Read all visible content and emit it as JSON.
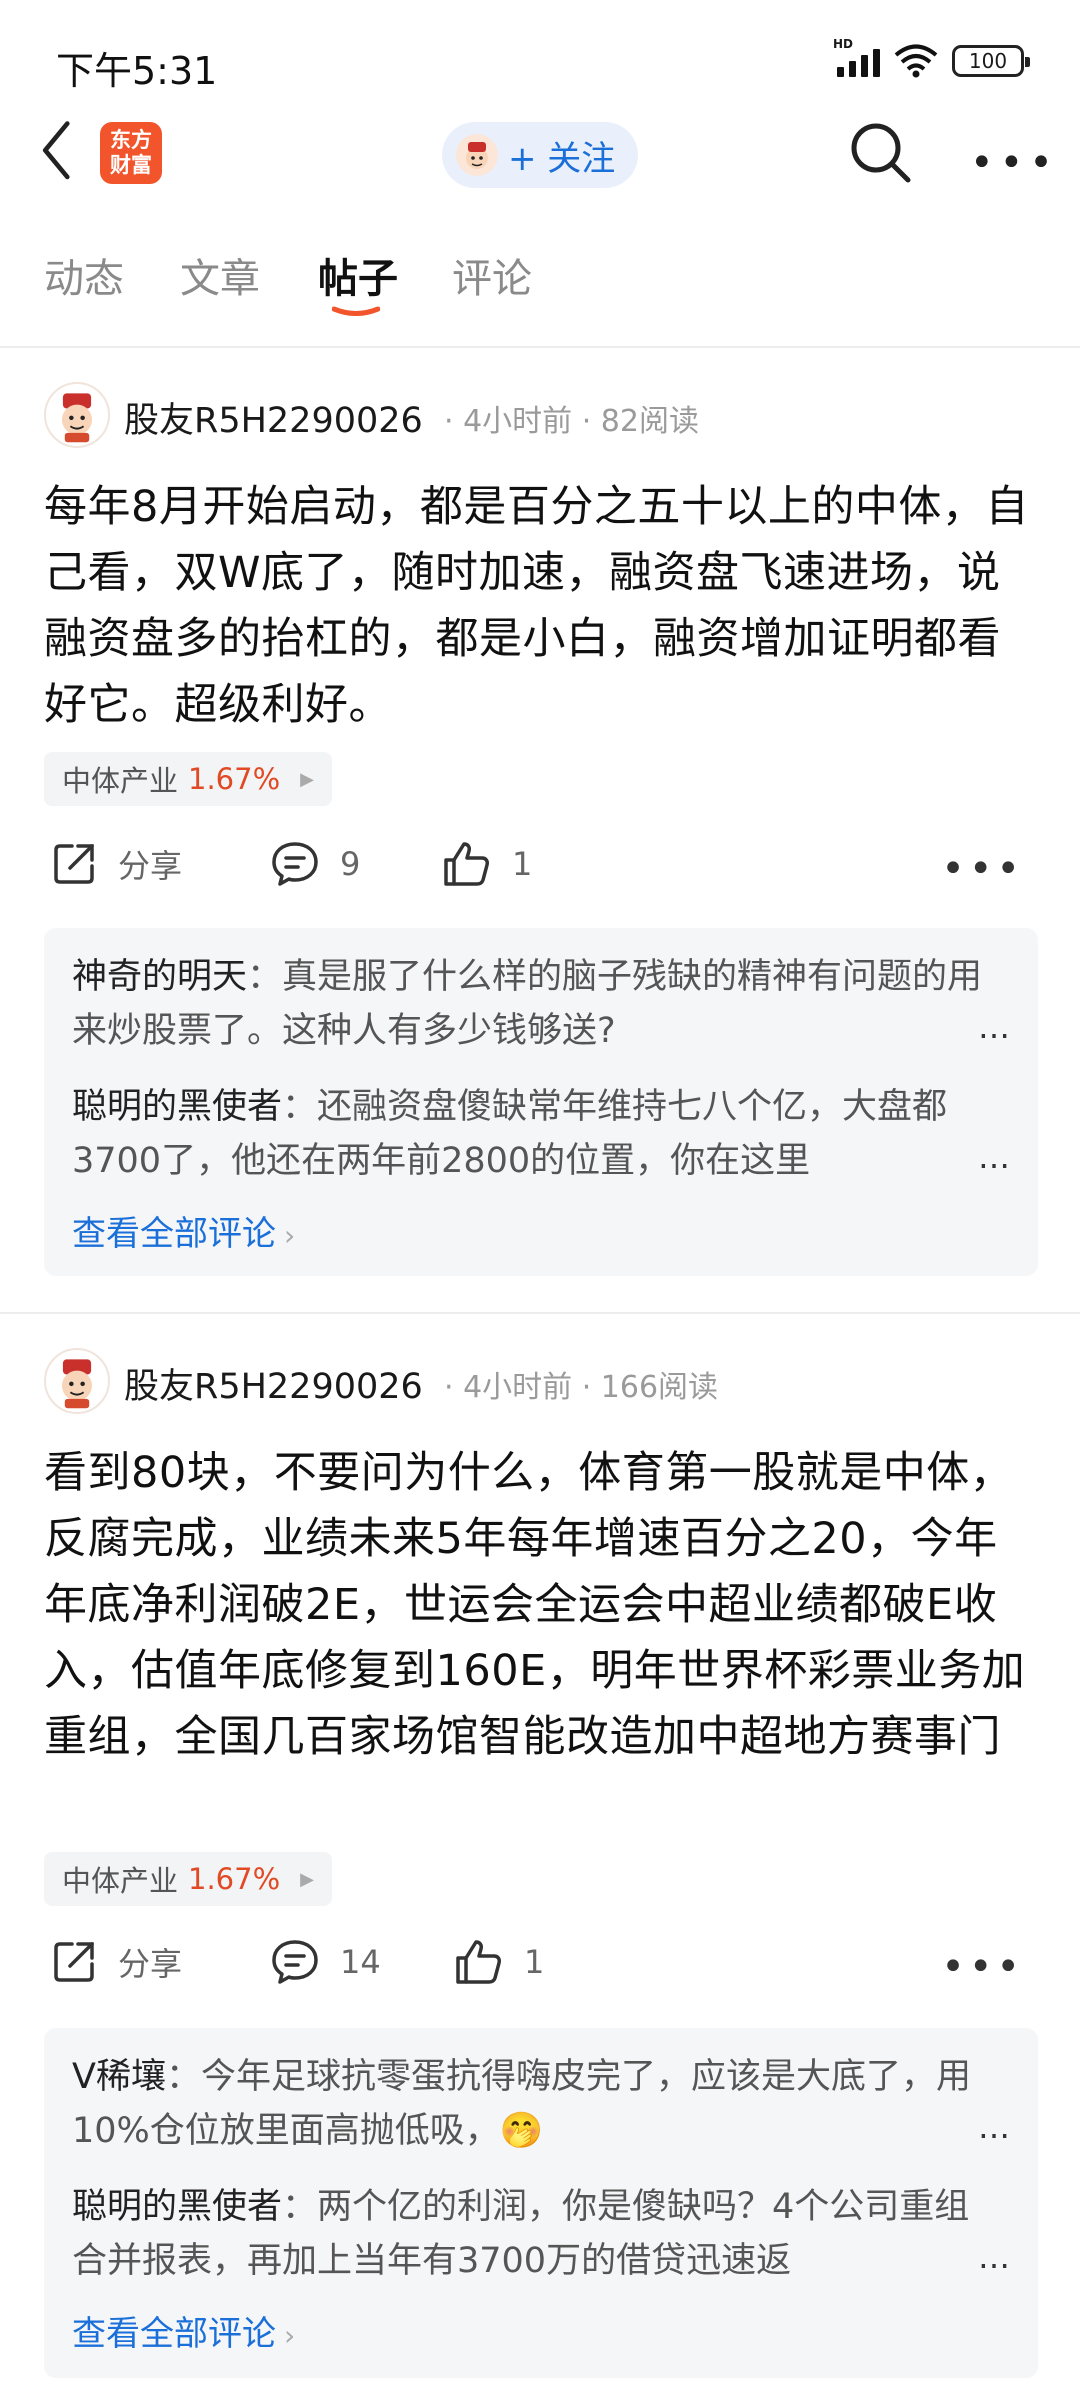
{
  "status_bar": {
    "time": "下午5:31",
    "network": "HD",
    "battery": "100"
  },
  "header": {
    "logo_text": "东方财富",
    "logo_line1": "东方",
    "logo_line2": "财富",
    "follow_label": "+ 关注",
    "accent_color": "#1b6fd8",
    "brand_color": "#f2552c"
  },
  "tabs": [
    {
      "label": "动态"
    },
    {
      "label": "文章"
    },
    {
      "label": "帖子",
      "active": true
    },
    {
      "label": "评论"
    }
  ],
  "posts": [
    {
      "author": "股友R5H2290026",
      "time": "4小时前",
      "reads": "82阅读",
      "body": "每年8月开始启动，都是百分之五十以上的中体，自己看，双W底了，随时加速，融资盘飞速进场，说融资盘多的抬杠的，都是小白，融资增加证明都看好它。超级利好。",
      "stock_name": "中体产业",
      "stock_change": "1.67%",
      "share_label": "分享",
      "comments_count": "9",
      "likes_count": "1",
      "comments": [
        {
          "name": "神奇的明天",
          "text": "真是服了什么样的脑子残缺的精神有问题的用来炒股票了。这种人有多少钱够送?"
        },
        {
          "name": "聪明的黑使者",
          "text": "还融资盘傻缺常年维持七八个亿，大盘都3700了，他还在两年前2800的位置，你在这里"
        }
      ],
      "view_all": "查看全部评论"
    },
    {
      "author": "股友R5H2290026",
      "time": "4小时前",
      "reads": "166阅读",
      "body": "看到80块，不要问为什么，体育第一股就是中体，反腐完成，业绩未来5年每年增速百分之20，今年年底净利润破2E，世运会全运会中超业绩都破E收入，估值年底修复到160E，明年世界杯彩票业务加重组，全国几百家场馆智能改造加中超地方赛事门票分成，国家补助估值修复到…",
      "stock_name": "中体产业",
      "stock_change": "1.67%",
      "share_label": "分享",
      "comments_count": "14",
      "likes_count": "1",
      "comments": [
        {
          "name": "V稀壤",
          "text": "今年足球抗零蛋抗得嗨皮完了，应该是大底了，用10%仓位放里面高抛低吸，",
          "emoji": "🤭"
        },
        {
          "name": "聪明的黑使者",
          "text": "两个亿的利润，你是傻缺吗？4个公司重组合并报表，再加上当年有3700万的借贷迅速返"
        }
      ],
      "view_all": "查看全部评论"
    }
  ],
  "colors": {
    "stock_up": "#e04a24",
    "link": "#1b6fd8",
    "tab_underline": "#f2552c"
  }
}
